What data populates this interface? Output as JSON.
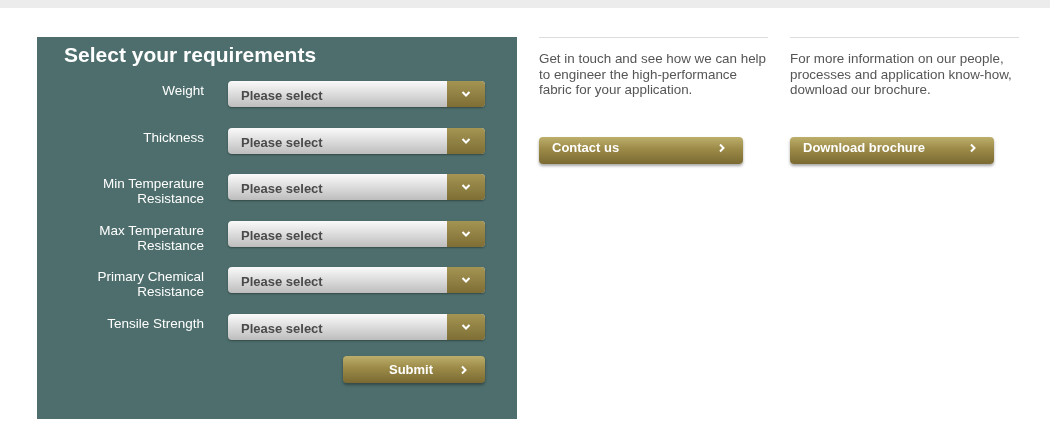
{
  "form": {
    "title": "Select your requirements",
    "fields": [
      {
        "label": "Weight",
        "placeholder": "Please select"
      },
      {
        "label": "Thickness",
        "placeholder": "Please select"
      },
      {
        "label": "Min Temperature Resistance",
        "placeholder": "Please select"
      },
      {
        "label": "Max Temperature Resistance",
        "placeholder": "Please select"
      },
      {
        "label": "Primary Chemical Resistance",
        "placeholder": "Please select"
      },
      {
        "label": "Tensile Strength",
        "placeholder": "Please select"
      }
    ],
    "submit": "Submit"
  },
  "columns": [
    {
      "text": "Get in touch and see how we can help to engineer the high-performance fabric for your application.",
      "button": "Contact us"
    },
    {
      "text": "For more information on our people, processes and application know-how, download our brochure.",
      "button": "Download brochure"
    }
  ]
}
